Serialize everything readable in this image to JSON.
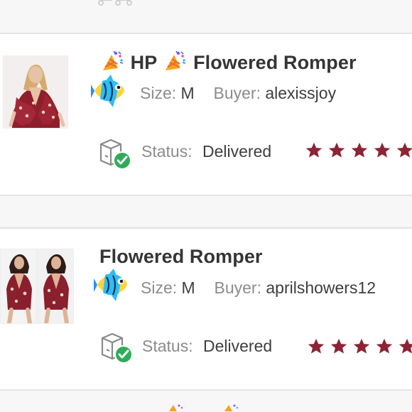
{
  "orders": [
    {
      "title_prefix": "HP",
      "title": "Flowered Romper",
      "size_label": "Size:",
      "size_value": "M",
      "buyer_label": "Buyer:",
      "buyer_value": "alexissjoy",
      "status_label": "Status:",
      "status_value": "Delivered",
      "rating": 5,
      "thumbnail": "romper-photo-single",
      "emoji": [
        "party-popper-icon",
        "tropical-fish-icon"
      ]
    },
    {
      "title": "Flowered Romper",
      "size_label": "Size:",
      "size_value": "M",
      "buyer_label": "Buyer:",
      "buyer_value": "aprilshowers12",
      "status_label": "Status:",
      "status_value": "Delivered",
      "rating": 5,
      "thumbnail": "romper-photo-double",
      "emoji": [
        "tropical-fish-icon"
      ]
    }
  ],
  "colors": {
    "star": "#8c2435",
    "check": "#2ead56",
    "label": "#8c8c8c",
    "value": "#3e3e3e",
    "title": "#353535"
  }
}
